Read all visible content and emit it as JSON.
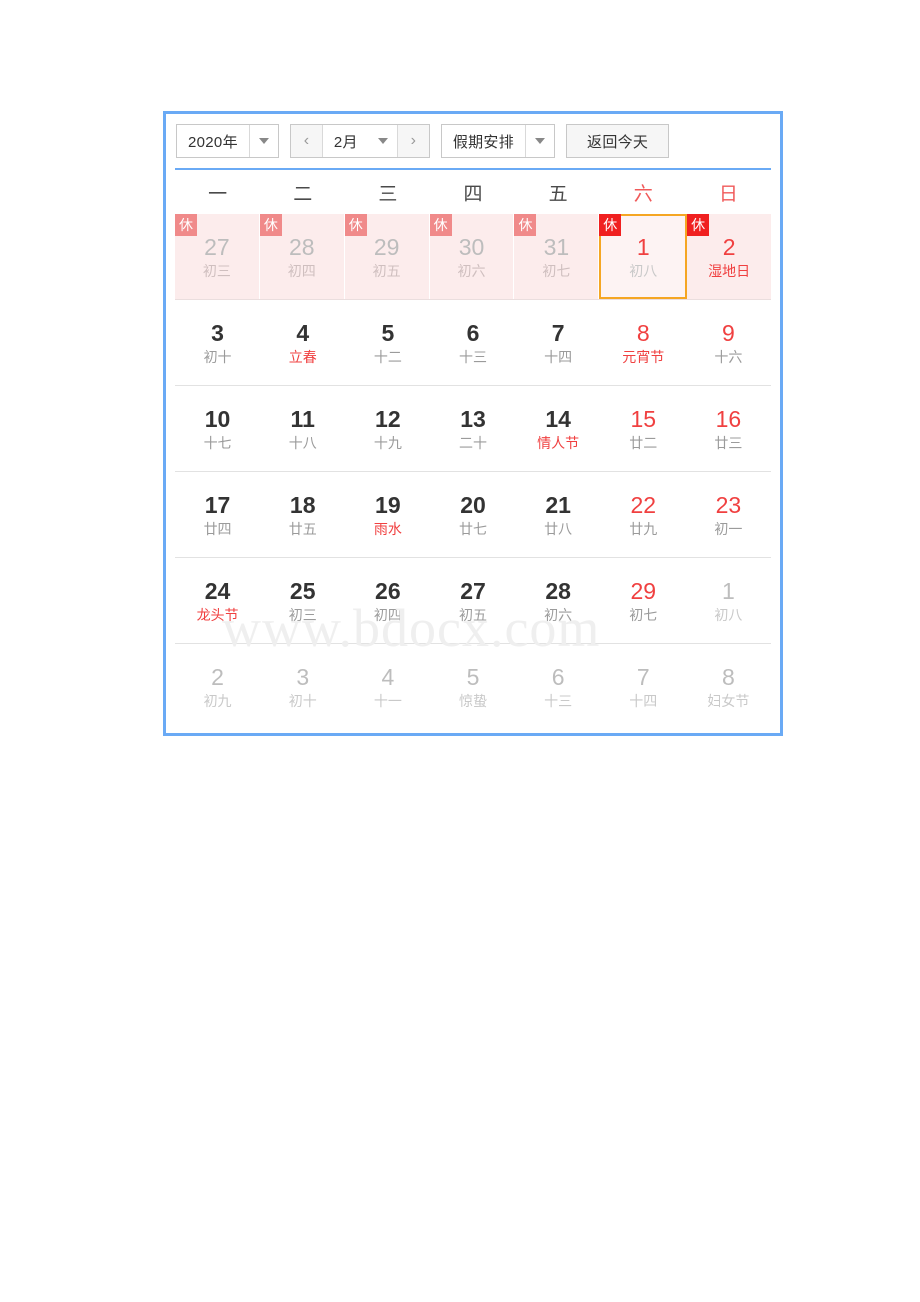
{
  "widget": {
    "name": "chinese-lunar-calendar",
    "frame_border_color": "#6aaaf5",
    "divider_color": "#6aaaf5",
    "selected_border_color": "#f5a623",
    "rest_day_bg": "#fcecec",
    "weekend_color": "#f05a5a"
  },
  "toolbar": {
    "year_label": "2020年",
    "month_label": "2月",
    "prev_month_icon": "‹",
    "next_month_icon": "›",
    "holiday_label": "假期安排",
    "today_label": "返回今天"
  },
  "weekdays": [
    {
      "label": "一",
      "weekend": false
    },
    {
      "label": "二",
      "weekend": false
    },
    {
      "label": "三",
      "weekend": false
    },
    {
      "label": "四",
      "weekend": false
    },
    {
      "label": "五",
      "weekend": false
    },
    {
      "label": "六",
      "weekend": true
    },
    {
      "label": "日",
      "weekend": true
    }
  ],
  "rest_badge_label": "休",
  "weeks": [
    {
      "rest_row": true,
      "days": [
        {
          "num": "27",
          "lunar": "初三",
          "num_style": "num-muted",
          "lunar_style": "lunar-faint",
          "rest": true,
          "badge": "faint",
          "selected": false
        },
        {
          "num": "28",
          "lunar": "初四",
          "num_style": "num-muted",
          "lunar_style": "lunar-faint",
          "rest": true,
          "badge": "faint",
          "selected": false
        },
        {
          "num": "29",
          "lunar": "初五",
          "num_style": "num-muted",
          "lunar_style": "lunar-faint",
          "rest": true,
          "badge": "faint",
          "selected": false
        },
        {
          "num": "30",
          "lunar": "初六",
          "num_style": "num-muted",
          "lunar_style": "lunar-faint",
          "rest": true,
          "badge": "faint",
          "selected": false
        },
        {
          "num": "31",
          "lunar": "初七",
          "num_style": "num-muted",
          "lunar_style": "lunar-faint",
          "rest": true,
          "badge": "faint",
          "selected": false
        },
        {
          "num": "1",
          "lunar": "初八",
          "num_style": "num-red",
          "lunar_style": "lunar-muted",
          "rest": true,
          "badge": "strong",
          "selected": true
        },
        {
          "num": "2",
          "lunar": "湿地日",
          "num_style": "num-red",
          "lunar_style": "lunar-red",
          "rest": true,
          "badge": "strong",
          "selected": false
        }
      ]
    },
    {
      "rest_row": false,
      "days": [
        {
          "num": "3",
          "lunar": "初十",
          "num_style": "",
          "lunar_style": "",
          "rest": false,
          "badge": "none",
          "selected": false
        },
        {
          "num": "4",
          "lunar": "立春",
          "num_style": "",
          "lunar_style": "lunar-red",
          "rest": false,
          "badge": "none",
          "selected": false
        },
        {
          "num": "5",
          "lunar": "十二",
          "num_style": "",
          "lunar_style": "",
          "rest": false,
          "badge": "none",
          "selected": false
        },
        {
          "num": "6",
          "lunar": "十三",
          "num_style": "",
          "lunar_style": "",
          "rest": false,
          "badge": "none",
          "selected": false
        },
        {
          "num": "7",
          "lunar": "十四",
          "num_style": "",
          "lunar_style": "",
          "rest": false,
          "badge": "none",
          "selected": false
        },
        {
          "num": "8",
          "lunar": "元宵节",
          "num_style": "num-red",
          "lunar_style": "lunar-red",
          "rest": false,
          "badge": "none",
          "selected": false
        },
        {
          "num": "9",
          "lunar": "十六",
          "num_style": "num-red",
          "lunar_style": "",
          "rest": false,
          "badge": "none",
          "selected": false
        }
      ]
    },
    {
      "rest_row": false,
      "days": [
        {
          "num": "10",
          "lunar": "十七",
          "num_style": "",
          "lunar_style": "",
          "rest": false,
          "badge": "none",
          "selected": false
        },
        {
          "num": "11",
          "lunar": "十八",
          "num_style": "",
          "lunar_style": "",
          "rest": false,
          "badge": "none",
          "selected": false
        },
        {
          "num": "12",
          "lunar": "十九",
          "num_style": "",
          "lunar_style": "",
          "rest": false,
          "badge": "none",
          "selected": false
        },
        {
          "num": "13",
          "lunar": "二十",
          "num_style": "",
          "lunar_style": "",
          "rest": false,
          "badge": "none",
          "selected": false
        },
        {
          "num": "14",
          "lunar": "情人节",
          "num_style": "",
          "lunar_style": "lunar-red",
          "rest": false,
          "badge": "none",
          "selected": false
        },
        {
          "num": "15",
          "lunar": "廿二",
          "num_style": "num-red",
          "lunar_style": "",
          "rest": false,
          "badge": "none",
          "selected": false
        },
        {
          "num": "16",
          "lunar": "廿三",
          "num_style": "num-red",
          "lunar_style": "",
          "rest": false,
          "badge": "none",
          "selected": false
        }
      ]
    },
    {
      "rest_row": false,
      "days": [
        {
          "num": "17",
          "lunar": "廿四",
          "num_style": "",
          "lunar_style": "",
          "rest": false,
          "badge": "none",
          "selected": false
        },
        {
          "num": "18",
          "lunar": "廿五",
          "num_style": "",
          "lunar_style": "",
          "rest": false,
          "badge": "none",
          "selected": false
        },
        {
          "num": "19",
          "lunar": "雨水",
          "num_style": "",
          "lunar_style": "lunar-red",
          "rest": false,
          "badge": "none",
          "selected": false
        },
        {
          "num": "20",
          "lunar": "廿七",
          "num_style": "",
          "lunar_style": "",
          "rest": false,
          "badge": "none",
          "selected": false
        },
        {
          "num": "21",
          "lunar": "廿八",
          "num_style": "",
          "lunar_style": "",
          "rest": false,
          "badge": "none",
          "selected": false
        },
        {
          "num": "22",
          "lunar": "廿九",
          "num_style": "num-red",
          "lunar_style": "",
          "rest": false,
          "badge": "none",
          "selected": false
        },
        {
          "num": "23",
          "lunar": "初一",
          "num_style": "num-red",
          "lunar_style": "",
          "rest": false,
          "badge": "none",
          "selected": false
        }
      ]
    },
    {
      "rest_row": false,
      "days": [
        {
          "num": "24",
          "lunar": "龙头节",
          "num_style": "",
          "lunar_style": "lunar-red",
          "rest": false,
          "badge": "none",
          "selected": false
        },
        {
          "num": "25",
          "lunar": "初三",
          "num_style": "",
          "lunar_style": "",
          "rest": false,
          "badge": "none",
          "selected": false
        },
        {
          "num": "26",
          "lunar": "初四",
          "num_style": "",
          "lunar_style": "",
          "rest": false,
          "badge": "none",
          "selected": false
        },
        {
          "num": "27",
          "lunar": "初五",
          "num_style": "",
          "lunar_style": "",
          "rest": false,
          "badge": "none",
          "selected": false
        },
        {
          "num": "28",
          "lunar": "初六",
          "num_style": "",
          "lunar_style": "",
          "rest": false,
          "badge": "none",
          "selected": false
        },
        {
          "num": "29",
          "lunar": "初七",
          "num_style": "num-red",
          "lunar_style": "",
          "rest": false,
          "badge": "none",
          "selected": false
        },
        {
          "num": "1",
          "lunar": "初八",
          "num_style": "num-muted",
          "lunar_style": "lunar-muted",
          "rest": false,
          "badge": "none",
          "selected": false
        }
      ]
    },
    {
      "rest_row": false,
      "last": true,
      "days": [
        {
          "num": "2",
          "lunar": "初九",
          "num_style": "num-muted",
          "lunar_style": "lunar-muted",
          "rest": false,
          "badge": "none",
          "selected": false
        },
        {
          "num": "3",
          "lunar": "初十",
          "num_style": "num-muted",
          "lunar_style": "lunar-muted",
          "rest": false,
          "badge": "none",
          "selected": false
        },
        {
          "num": "4",
          "lunar": "十一",
          "num_style": "num-muted",
          "lunar_style": "lunar-muted",
          "rest": false,
          "badge": "none",
          "selected": false
        },
        {
          "num": "5",
          "lunar": "惊蛰",
          "num_style": "num-muted",
          "lunar_style": "lunar-muted",
          "rest": false,
          "badge": "none",
          "selected": false
        },
        {
          "num": "6",
          "lunar": "十三",
          "num_style": "num-muted",
          "lunar_style": "lunar-muted",
          "rest": false,
          "badge": "none",
          "selected": false
        },
        {
          "num": "7",
          "lunar": "十四",
          "num_style": "num-muted",
          "lunar_style": "lunar-muted",
          "rest": false,
          "badge": "none",
          "selected": false
        },
        {
          "num": "8",
          "lunar": "妇女节",
          "num_style": "num-muted",
          "lunar_style": "lunar-muted",
          "rest": false,
          "badge": "none",
          "selected": false
        }
      ]
    }
  ],
  "watermark": {
    "text": "www.bdocx.com"
  }
}
